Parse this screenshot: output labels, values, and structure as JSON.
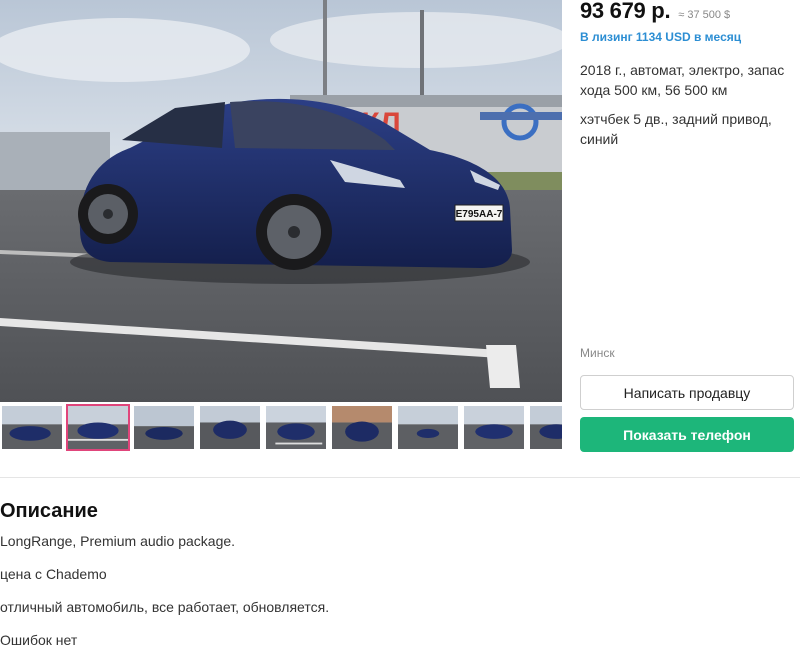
{
  "listing": {
    "price": "93 679 р.",
    "price_usd": "≈ 37 500 $",
    "leasing": "В лизинг 1134 USD в месяц",
    "specs_line1": "2018 г., автомат, электро, запас хода 500 км, 56 500 км",
    "specs_line2": "хэтчбек 5 дв., задний привод, синий",
    "city": "Минск",
    "plate": "Е795АА-7",
    "store_sign": "ОКЛ"
  },
  "buttons": {
    "write_seller": "Написать продавцу",
    "show_phone": "Показать телефон"
  },
  "thumbnails": {
    "count": 9,
    "active_index": 1
  },
  "description": {
    "title": "Описание",
    "lines": [
      "LongRange, Premium audio package.",
      "цена с Chademo",
      "отличный автомобиль, все работает, обновляется.",
      "Ошибок нет"
    ]
  },
  "colors": {
    "accent_green": "#1db67a",
    "link_blue": "#2c8ed3",
    "thumb_active": "#e0457b",
    "car_blue": "#1f2f6e"
  }
}
